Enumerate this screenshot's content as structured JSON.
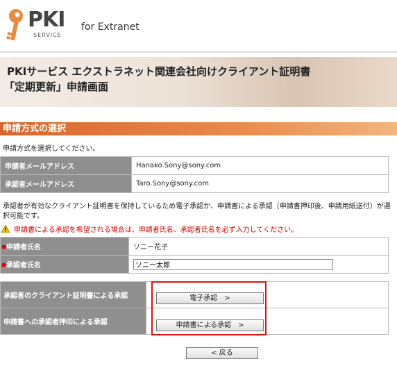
{
  "header": {
    "logo_text": "PKI",
    "logo_subtext": "SERVICE",
    "tagline": "for Extranet"
  },
  "banner": {
    "line1": "PKIサービス エクストラネット関連会社向けクライアント証明書",
    "line2": "「定期更新」申請画面"
  },
  "section": {
    "title": "申請方式の選択",
    "instruction": "申請方式を選択してください。"
  },
  "email_table": {
    "applicant_email_label": "申請者メールアドレス",
    "applicant_email_value": "Hanako.Sony@sony.com",
    "approver_email_label": "承認者メールアドレス",
    "approver_email_value": "Taro.Sony@sony.com"
  },
  "description": "承認者が有効なクライアント証明書を保持しているため電子承認か、申請書による承認（申請書押印後、申請用紙送付）が選択可能です。",
  "warning": "申請書による承認を希望される場合は、申請者氏名、承認者氏名を必ず入力してください。",
  "names_table": {
    "applicant_name_label": "申請者氏名",
    "applicant_name_value": "ソニー花子",
    "approver_name_label": "承認者氏名",
    "approver_name_value": "ソニー太郎"
  },
  "methods": {
    "electronic_label": "承認者のクライアント証明書による承認",
    "electronic_button": "電子承認　>",
    "document_label": "申請書への承認者押印による承認",
    "document_button": "申請書による承認　>"
  },
  "back_button": "< 戻る",
  "colors": {
    "section_header": "#e07a3e",
    "table_label_bg": "#8f8f8f",
    "warning_text": "#d40000",
    "highlight_border": "#e01010"
  }
}
